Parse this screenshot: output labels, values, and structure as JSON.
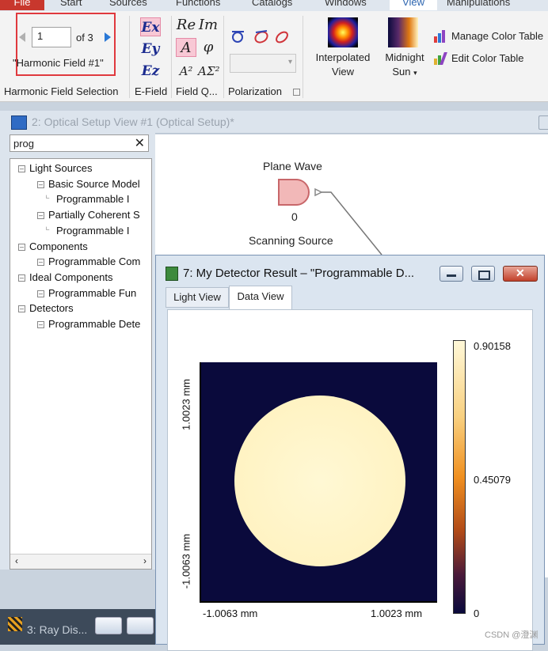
{
  "ribbon": {
    "tabs": [
      "File",
      "Start",
      "Sources",
      "Functions",
      "Catalogs",
      "Windows",
      "View",
      "Manipulations"
    ],
    "active_tab": "View",
    "field_selection": {
      "value": "1",
      "of_label": "of 3",
      "name": "\"Harmonic Field #1\"",
      "group_label": "Harmonic Field Selection"
    },
    "efield": {
      "buttons": [
        "Ex",
        "Ey",
        "Ez"
      ],
      "group_label": "E-Field"
    },
    "field_quantity": {
      "buttons": [
        "Re",
        "Im",
        "A",
        "φ",
        "A²",
        "AΣ²"
      ],
      "group_label": "Field Q..."
    },
    "polarization": {
      "group_label": "Polarization",
      "dropdown_value": ""
    },
    "interpolated_view": {
      "label": "Interpolated View"
    },
    "color_table": {
      "label": "Midnight Sun",
      "manage_label": "Manage Color Table",
      "edit_label": "Edit Color Table"
    }
  },
  "optical_setup": {
    "title": "2: Optical Setup View #1 (Optical Setup)*",
    "search_value": "prog",
    "tree": [
      {
        "label": "Light Sources",
        "level": 0
      },
      {
        "label": "Basic Source Model",
        "level": 1
      },
      {
        "label": "Programmable I",
        "level": 2
      },
      {
        "label": "Partially Coherent S",
        "level": 1
      },
      {
        "label": "Programmable I",
        "level": 2
      },
      {
        "label": "Components",
        "level": 0
      },
      {
        "label": "Programmable Com",
        "level": 1
      },
      {
        "label": "Ideal Components",
        "level": 0
      },
      {
        "label": "Programmable Fun",
        "level": 1
      },
      {
        "label": "Detectors",
        "level": 0
      },
      {
        "label": "Programmable Dete",
        "level": 1
      }
    ],
    "nodes": {
      "plane_wave": {
        "label": "Plane Wave",
        "index": "0"
      },
      "scanning_source": {
        "label": "Scanning Source"
      }
    }
  },
  "detector": {
    "title": "7: My Detector Result – \"Programmable D...",
    "tabs": [
      "Light View",
      "Data View"
    ],
    "active_tab": "Data View",
    "y_top": "1.0023 mm",
    "y_bottom": "-1.0063 mm",
    "x_left": "-1.0063 mm",
    "x_right": "1.0023 mm",
    "colorbar": {
      "max": "0.90158",
      "mid": "0.45079",
      "min": "0"
    }
  },
  "bottom_window": {
    "title": "3: Ray Dis..."
  },
  "watermark": "CSDN @澄渊",
  "colors": {
    "accent_red": "#e0393e",
    "file_tab": "#c8372d",
    "plot_bg": "#0a0a3c"
  }
}
